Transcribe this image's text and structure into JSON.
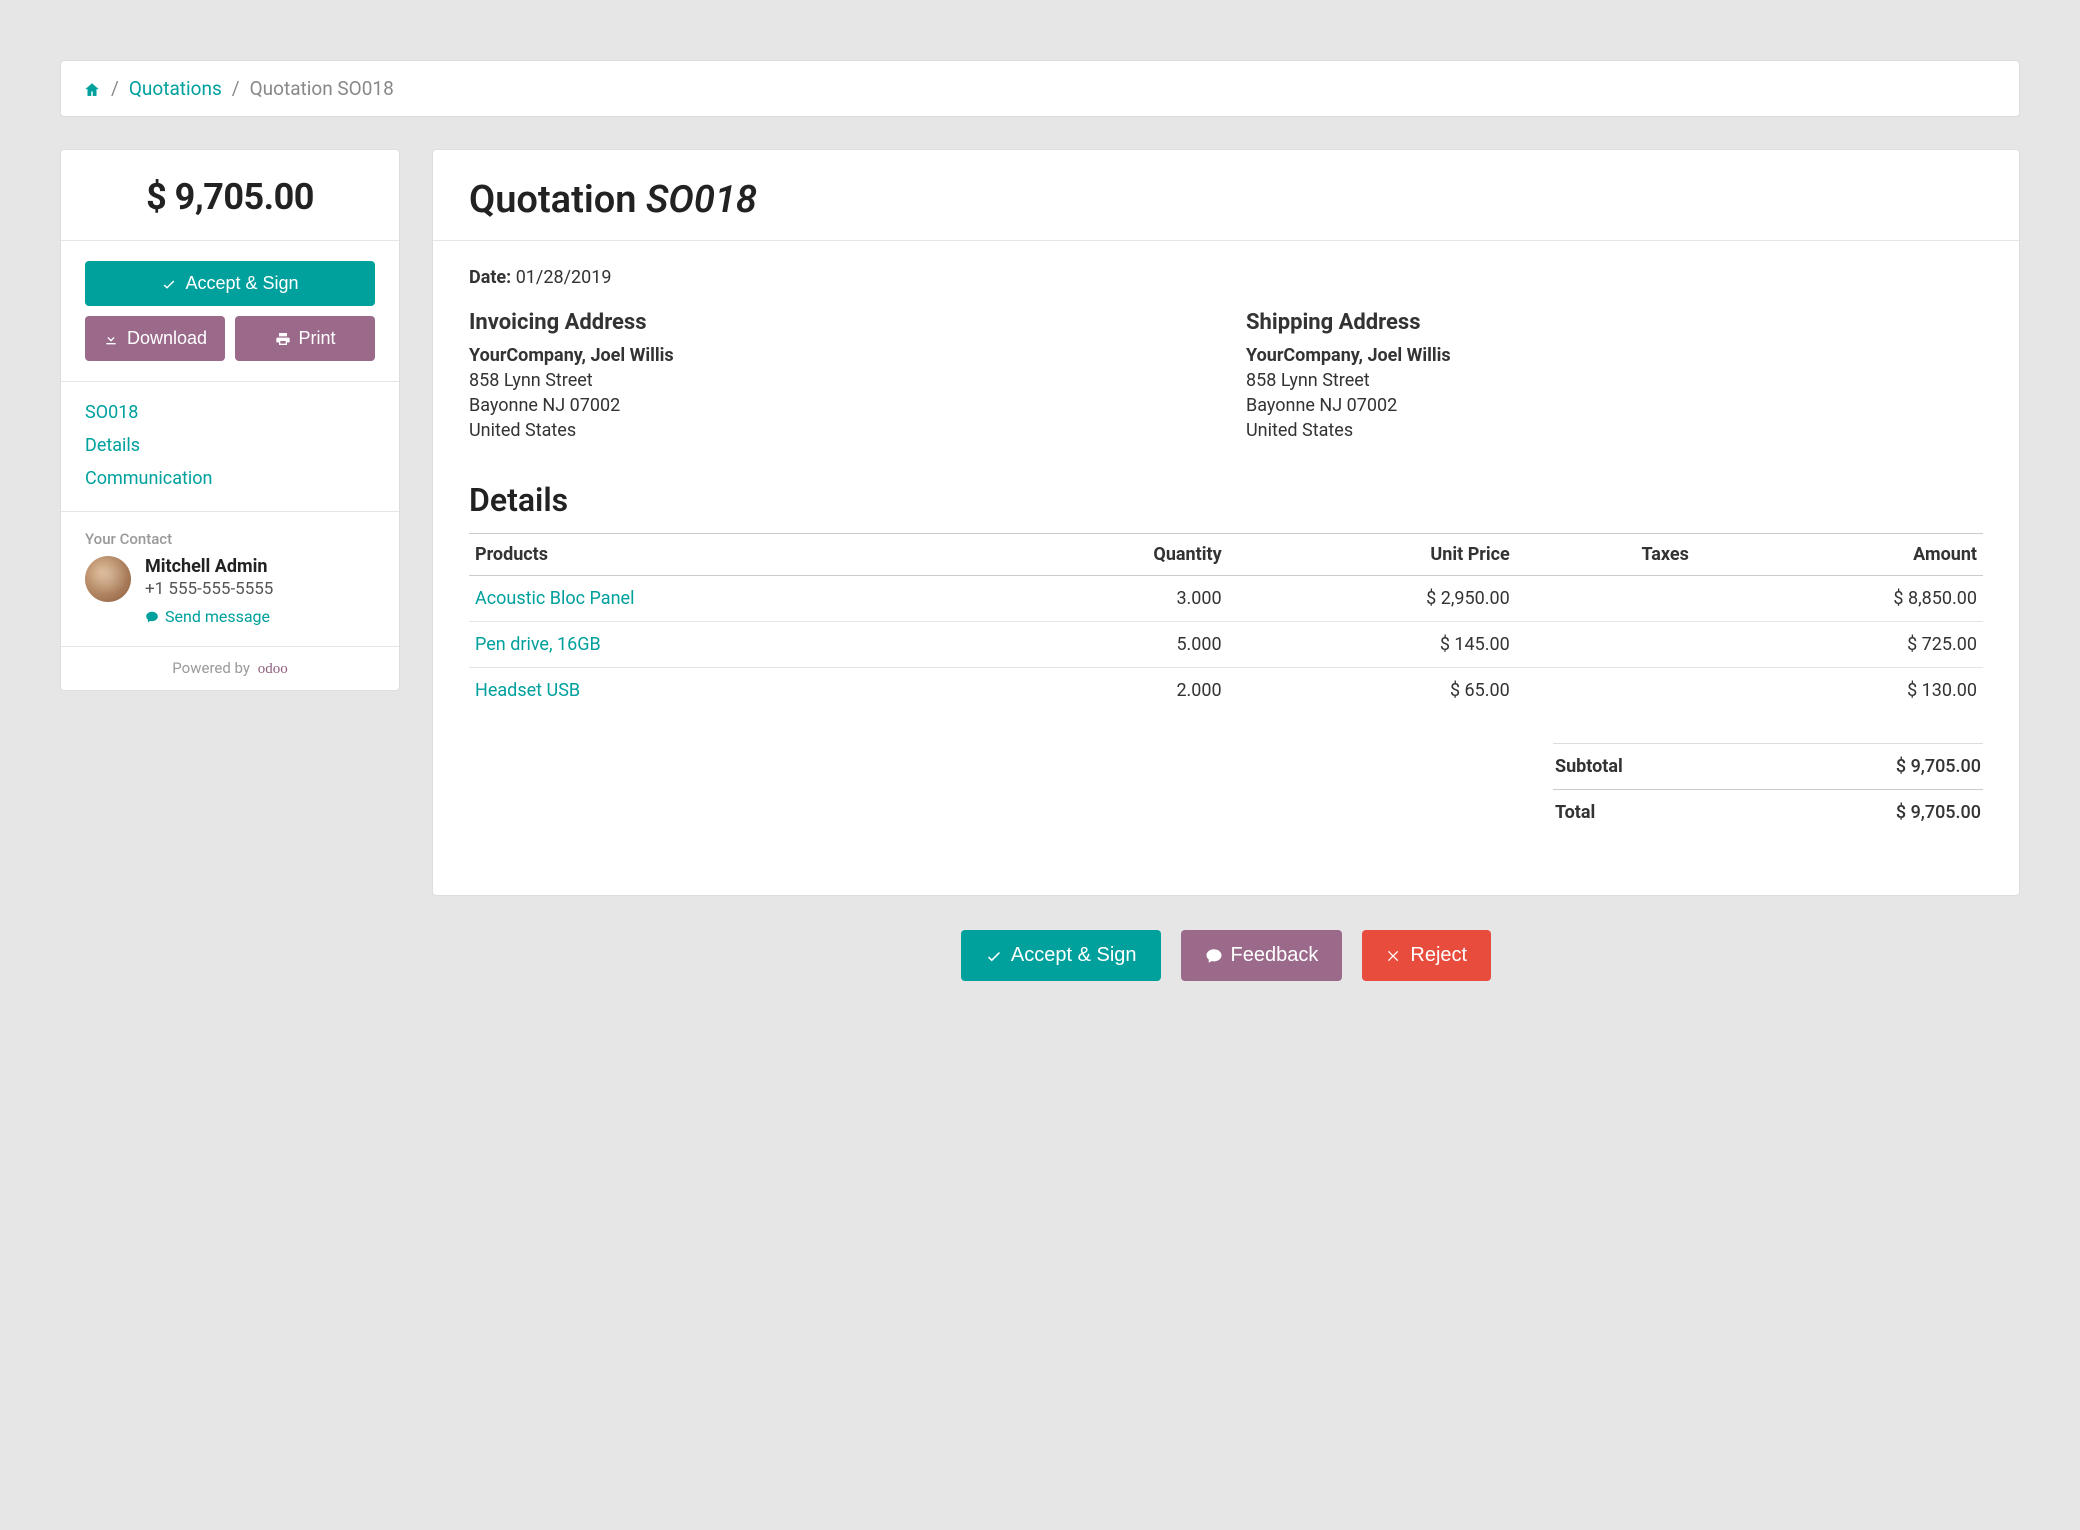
{
  "breadcrumb": {
    "quotations": "Quotations",
    "current": "Quotation SO018"
  },
  "sidebar": {
    "price": "$ 9,705.00",
    "btn_accept": "Accept & Sign",
    "btn_download": "Download",
    "btn_print": "Print",
    "nav": {
      "so": "SO018",
      "details": "Details",
      "communication": "Communication"
    },
    "contact": {
      "label": "Your Contact",
      "name": "Mitchell Admin",
      "phone": "+1 555-555-5555",
      "send": "Send message"
    },
    "powered": "Powered by",
    "powered_brand": "odoo"
  },
  "main": {
    "title_word": "Quotation",
    "title_id": "SO018",
    "date_label": "Date:",
    "date_value": "01/28/2019",
    "invoicing": {
      "heading": "Invoicing Address",
      "name": "YourCompany, Joel Willis",
      "street": "858 Lynn Street",
      "city": "Bayonne NJ 07002",
      "country": "United States"
    },
    "shipping": {
      "heading": "Shipping Address",
      "name": "YourCompany, Joel Willis",
      "street": "858 Lynn Street",
      "city": "Bayonne NJ 07002",
      "country": "United States"
    },
    "details_heading": "Details",
    "columns": {
      "products": "Products",
      "quantity": "Quantity",
      "unit_price": "Unit Price",
      "taxes": "Taxes",
      "amount": "Amount"
    },
    "rows": [
      {
        "product": "Acoustic Bloc Panel",
        "qty": "3.000",
        "unit": "$ 2,950.00",
        "tax": "",
        "amount": "$ 8,850.00"
      },
      {
        "product": "Pen drive, 16GB",
        "qty": "5.000",
        "unit": "$ 145.00",
        "tax": "",
        "amount": "$ 725.00"
      },
      {
        "product": "Headset USB",
        "qty": "2.000",
        "unit": "$ 65.00",
        "tax": "",
        "amount": "$ 130.00"
      }
    ],
    "totals": {
      "subtotal_label": "Subtotal",
      "subtotal_value": "$ 9,705.00",
      "total_label": "Total",
      "total_value": "$ 9,705.00"
    },
    "footer": {
      "accept": "Accept & Sign",
      "feedback": "Feedback",
      "reject": "Reject"
    }
  }
}
